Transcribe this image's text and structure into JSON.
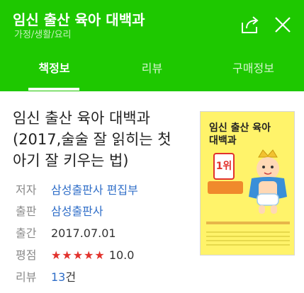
{
  "header": {
    "title": "임신 출산 육아 대백과",
    "category": "가정/생활/요리",
    "share_icon": "share-icon",
    "close_icon": "close-icon"
  },
  "tabs": [
    {
      "label": "책정보",
      "active": true
    },
    {
      "label": "리뷰",
      "active": false
    },
    {
      "label": "구매정보",
      "active": false
    }
  ],
  "book": {
    "title": "임신 출산 육아 대백과(2017,술술 잘 읽히는 첫 아기 잘 키우는 법)",
    "cover": {
      "title_line1": "임신 출산 육아",
      "title_line2": "대백과",
      "rank": "1위"
    },
    "author": {
      "label": "저자",
      "value": "삼성출판사 편집부"
    },
    "publisher": {
      "label": "출판",
      "value": "삼성출판사"
    },
    "date": {
      "label": "출간",
      "value": "2017.07.01"
    },
    "rating": {
      "label": "평점",
      "stars": "★★★★★",
      "score": "10.0"
    },
    "reviews": {
      "label": "리뷰",
      "count": "13",
      "unit": "건"
    }
  },
  "colors": {
    "brand": "#1ec800",
    "link": "#2f6ec8",
    "star": "#e2322c"
  }
}
